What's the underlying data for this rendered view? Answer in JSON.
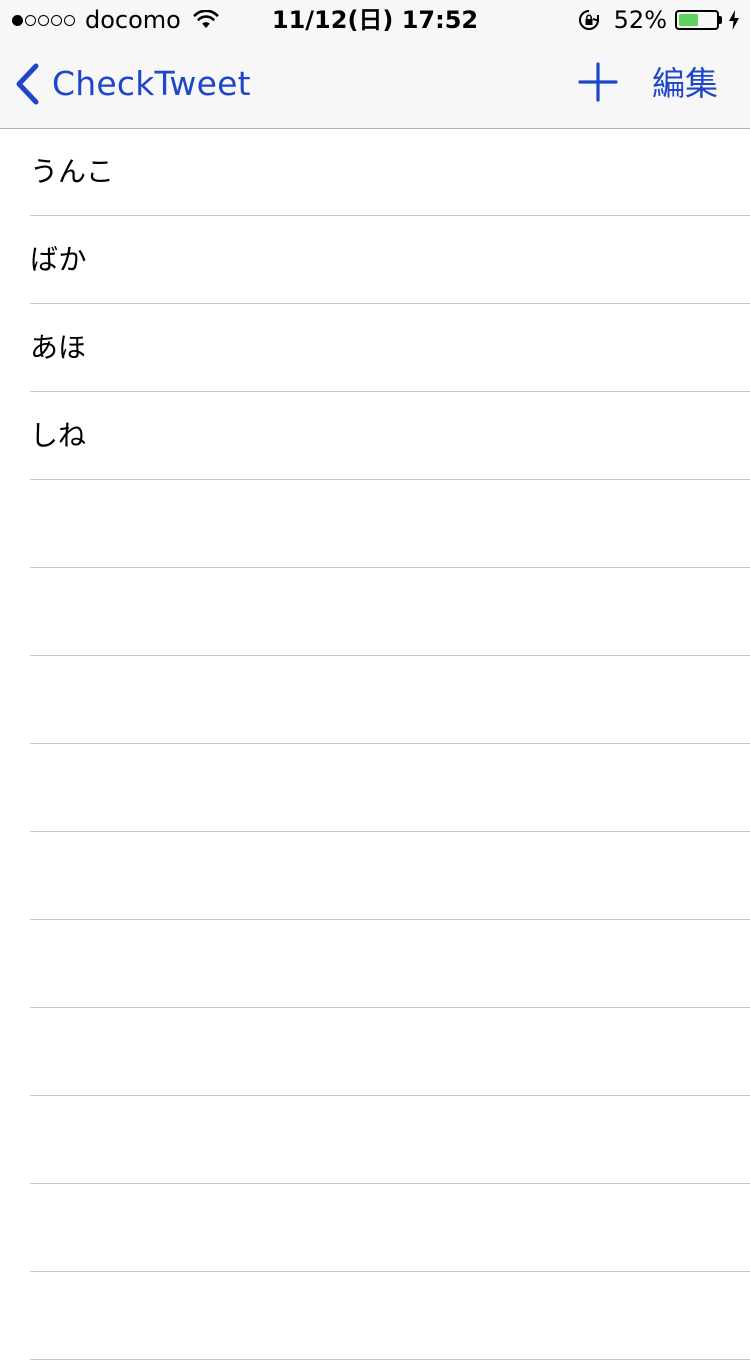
{
  "status_bar": {
    "signal_filled": 1,
    "signal_total": 5,
    "carrier": "docomo",
    "time": "11/12(日) 17:52",
    "battery_percent_label": "52%",
    "battery_level": 0.52,
    "charging": true
  },
  "nav": {
    "back_label": "CheckTweet",
    "add_icon": "plus-icon",
    "edit_label": "編集",
    "tint_color": "#1f45c9"
  },
  "list": {
    "items": [
      "うんこ",
      "ばか",
      "あほ",
      "しね",
      "",
      "",
      "",
      "",
      "",
      "",
      "",
      "",
      "",
      ""
    ]
  },
  "colors": {
    "bar_background": "#f7f7f7",
    "separator": "#c8c7cc",
    "battery_fill": "#5dd35f"
  }
}
